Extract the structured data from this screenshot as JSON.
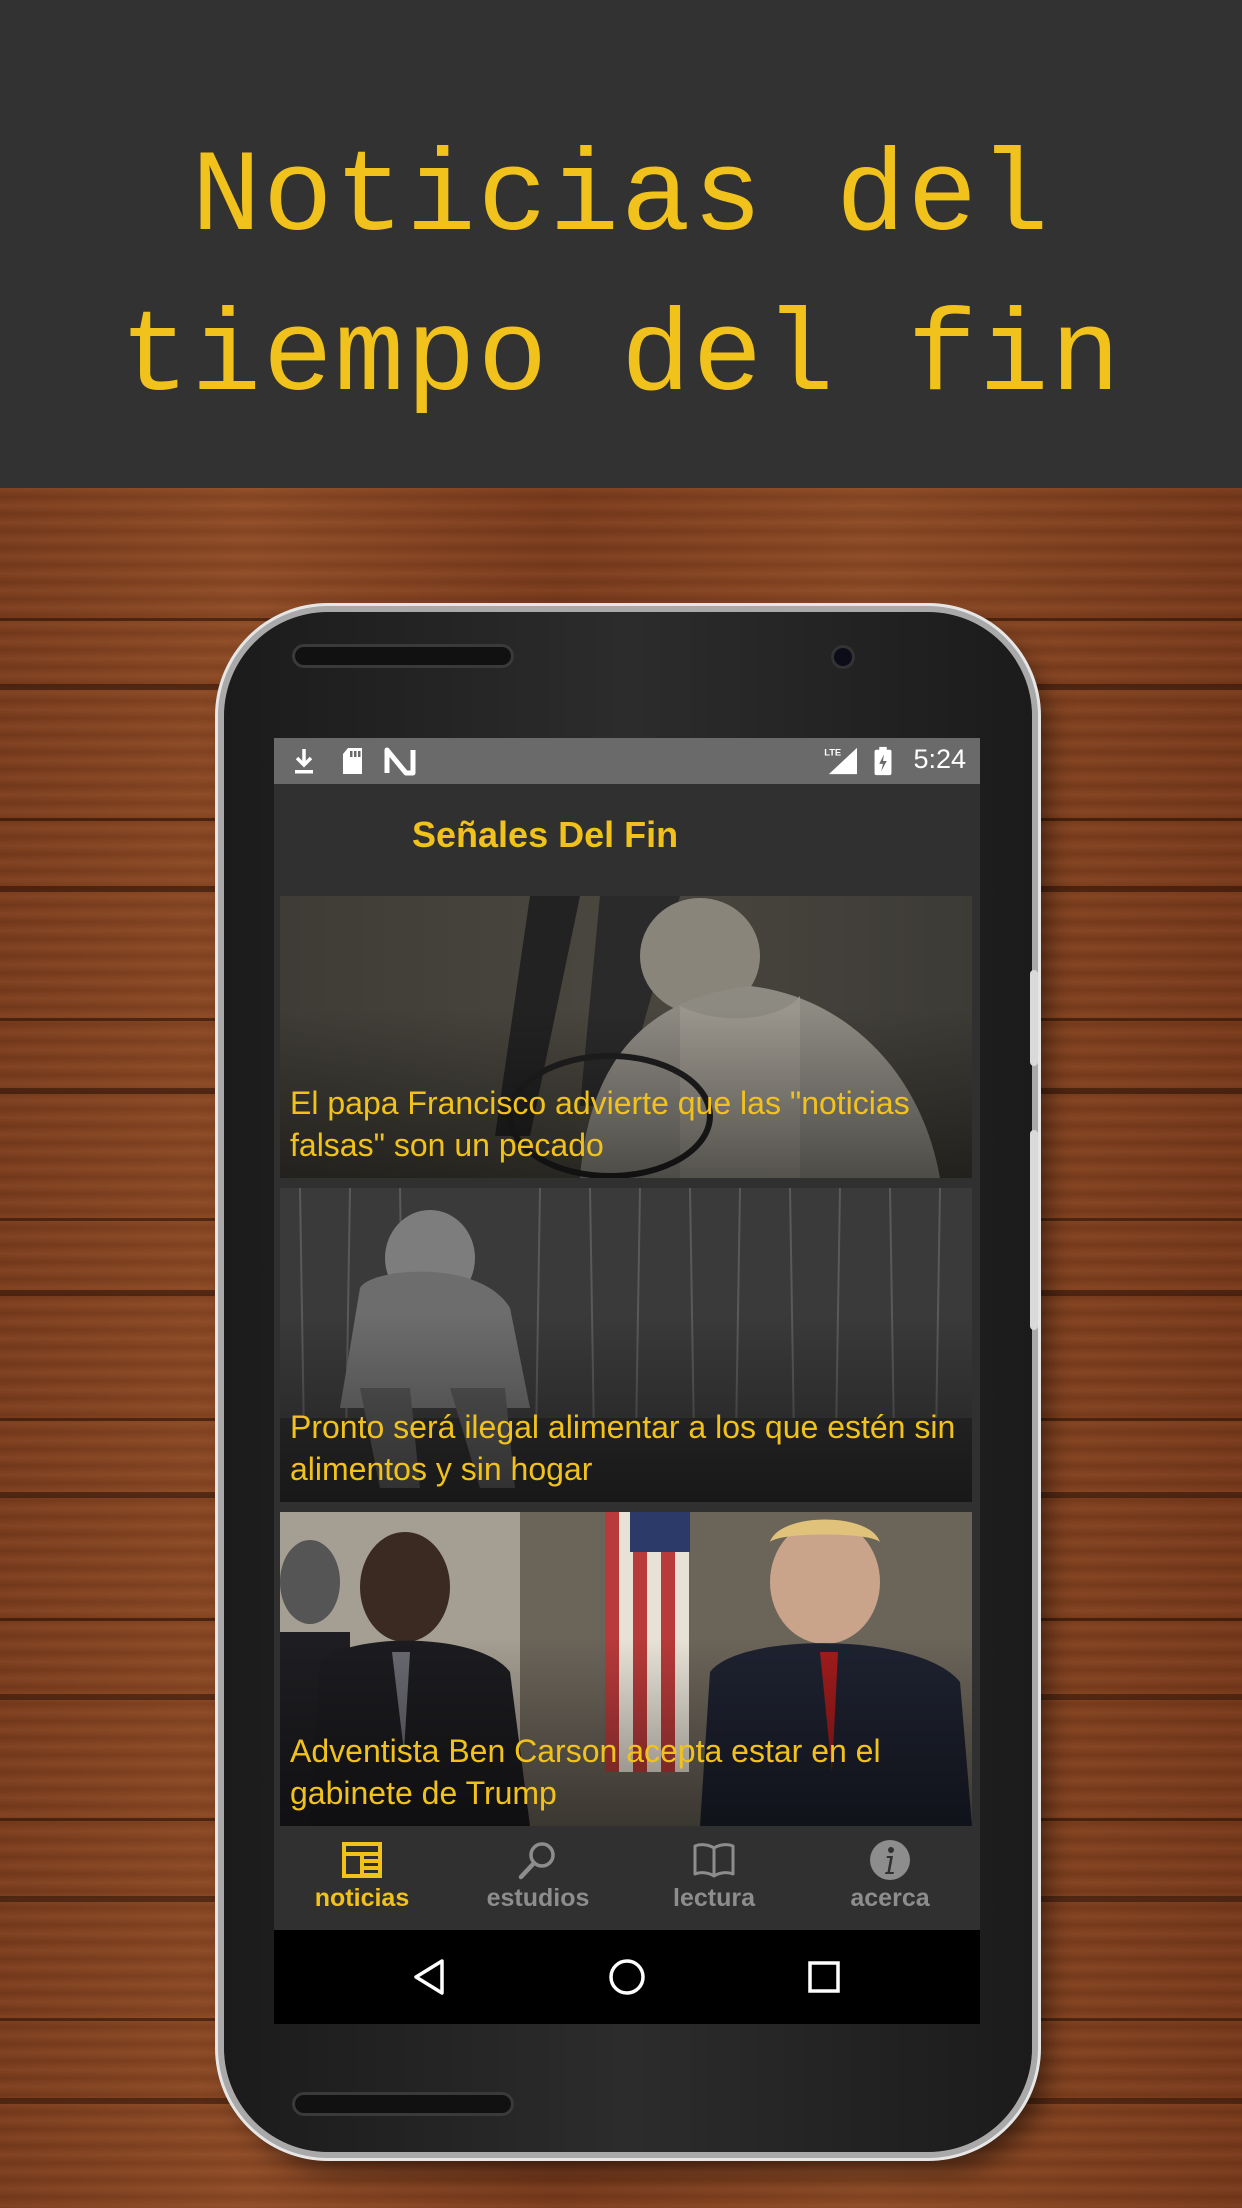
{
  "banner": {
    "title": "Noticias del\ntiempo del fin"
  },
  "statusbar": {
    "icons_left": [
      "download-icon",
      "sd-card-icon",
      "n-logo-icon"
    ],
    "icons_right": [
      "lte-signal-icon",
      "battery-icon"
    ],
    "network": "LTE",
    "time": "5:24"
  },
  "appbar": {
    "title": "Señales Del Fin"
  },
  "articles": [
    {
      "title": "El papa Francisco advierte que las \"noticias falsas\" son un pecado"
    },
    {
      "title": "Pronto será ilegal alimentar a los que estén sin alimentos y sin hogar"
    },
    {
      "title": "Adventista Ben Carson acepta estar en el gabinete de Trump"
    }
  ],
  "bottom_nav": [
    {
      "label": "noticias",
      "icon": "newspaper-icon",
      "active": true
    },
    {
      "label": "estudios",
      "icon": "search-icon",
      "active": false
    },
    {
      "label": "lectura",
      "icon": "book-icon",
      "active": false
    },
    {
      "label": "acerca",
      "icon": "info-icon",
      "active": false
    }
  ],
  "system_nav": [
    "back-icon",
    "home-icon",
    "recents-icon"
  ],
  "colors": {
    "accent": "#f1c21b",
    "banner_bg": "#323232",
    "screen_bg": "#303030",
    "inactive_nav": "#8d8d8d"
  }
}
